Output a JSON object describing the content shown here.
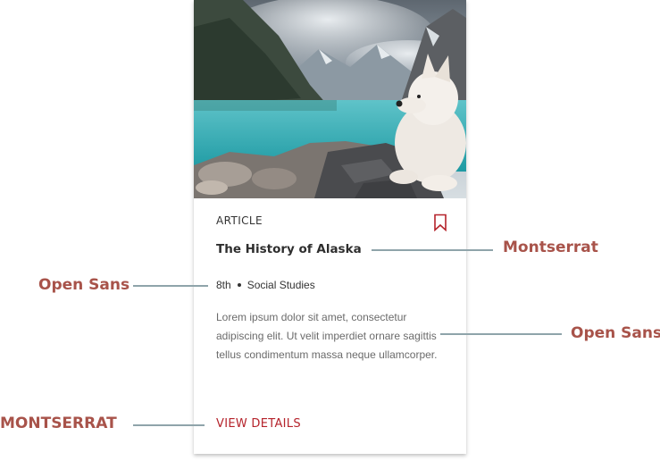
{
  "card": {
    "image": {
      "description_icon": "photo-lake-mountains-dog"
    },
    "type_label": "ARTICLE",
    "title": "The History of Alaska",
    "meta": {
      "grade": "8th",
      "subject": "Social Studies"
    },
    "description": "Lorem ipsum dolor sit amet, consectetur adipiscing elit. Ut velit imperdiet ornare sagittis tellus condimentum massa neque ullamcorper.",
    "cta_label": "VIEW DETAILS",
    "bookmark_icon": "bookmark-icon"
  },
  "annotations": {
    "title_font": "Montserrat",
    "meta_font": "Open Sans",
    "desc_font": "Open Sans",
    "cta_font": "MONTSERRAT"
  },
  "colors": {
    "accent": "#b5232b",
    "annotation_text": "#a8534a",
    "annotation_line": "#8fa4aa",
    "title_text": "#2e2e2e",
    "body_text": "#6b6b6b"
  }
}
